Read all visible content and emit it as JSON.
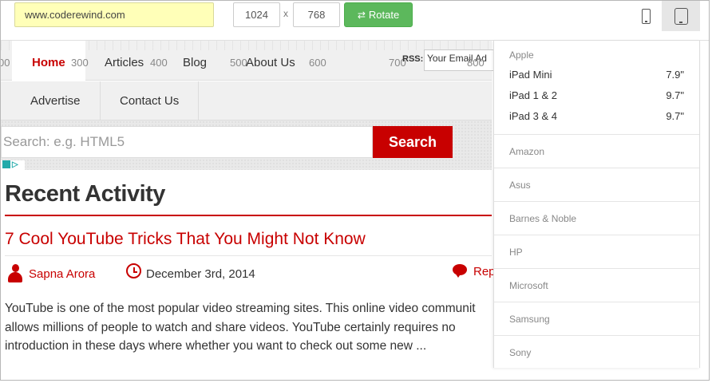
{
  "toolbar": {
    "url": "www.coderewind.com",
    "width": "1024",
    "separator": "x",
    "height": "768",
    "rotate_label": "Rotate",
    "rotate_icon": "rotate-icon",
    "phone_icon": "phone-icon",
    "tablet_icon": "tablet-icon"
  },
  "ruler": {
    "marks": [
      "00",
      "300",
      "400",
      "500",
      "600",
      "700",
      "800"
    ]
  },
  "site": {
    "nav_primary": [
      {
        "label": "Home",
        "active": true
      },
      {
        "label": "Articles"
      },
      {
        "label": "Blog"
      },
      {
        "label": "About Us"
      }
    ],
    "rss_label": "RSS:",
    "rss_placeholder": "Your Email Ad",
    "nav_secondary": [
      {
        "label": "Advertise"
      },
      {
        "label": "Contact Us"
      }
    ],
    "search_placeholder": "Search: e.g. HTML5",
    "search_button": "Search",
    "ad_label": "▷"
  },
  "content": {
    "section_title": "Recent Activity",
    "post_title": "7 Cool YouTube Tricks That You Might Not Know",
    "author": "Sapna Arora",
    "date": "December 3rd, 2014",
    "reply": "Rep",
    "excerpt_lines": [
      "YouTube is one of the most popular video streaming sites. This online video communit",
      "allows millions of people to watch and share videos. YouTube certainly requires no",
      "introduction in these days where whether you want to check out some new ..."
    ]
  },
  "device_menu": {
    "apple": {
      "title": "Apple",
      "devices": [
        {
          "name": "iPad Mini",
          "size": "7.9\""
        },
        {
          "name": "iPad 1 & 2",
          "size": "9.7\""
        },
        {
          "name": "iPad 3 & 4",
          "size": "9.7\""
        }
      ]
    },
    "brands": [
      "Amazon",
      "Asus",
      "Barnes & Noble",
      "HP",
      "Microsoft",
      "Samsung",
      "Sony"
    ]
  },
  "colors": {
    "accent_red": "#c80000",
    "rotate_green": "#5cb85c",
    "url_bg": "#ffffb8"
  }
}
